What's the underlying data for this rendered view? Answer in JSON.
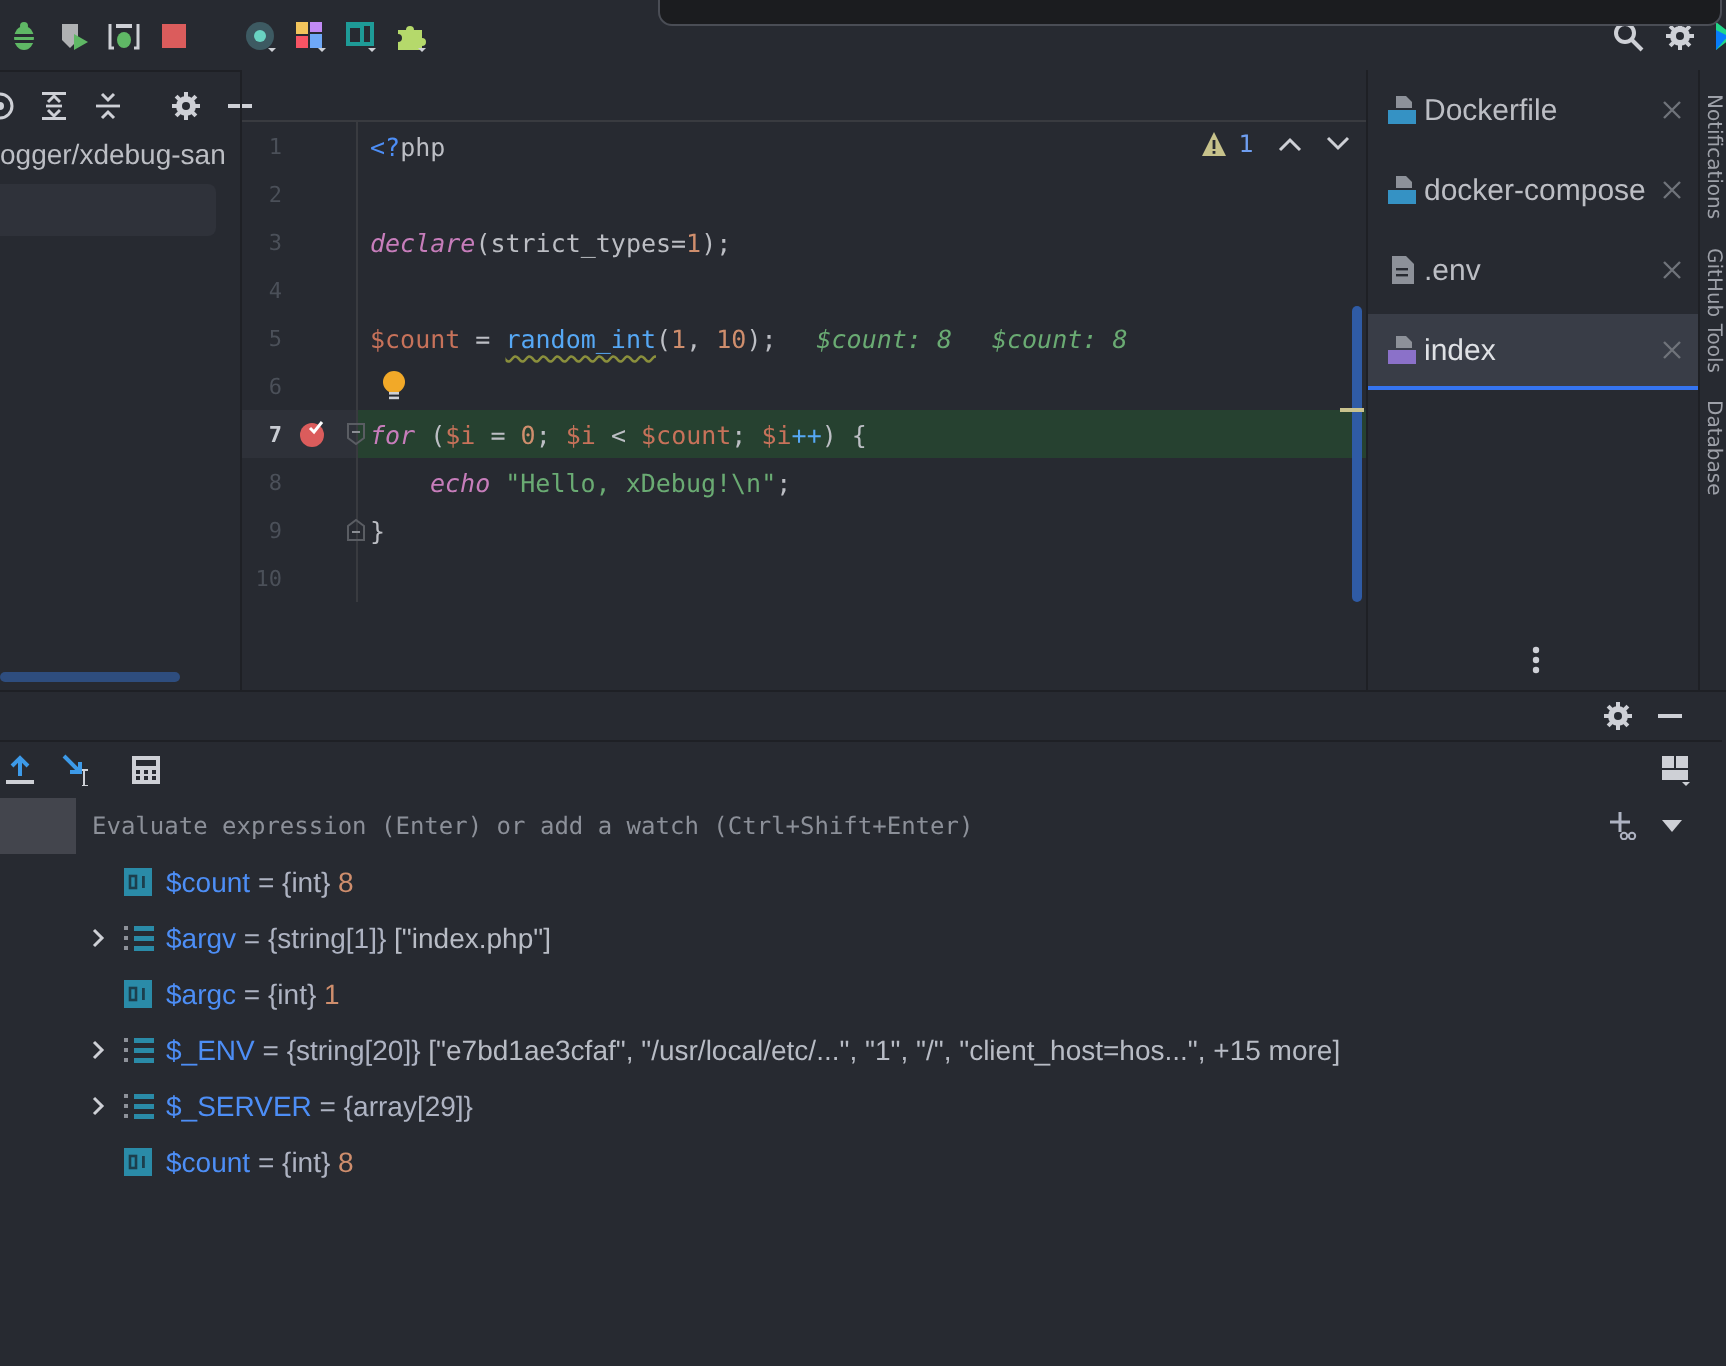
{
  "project": {
    "path": "ogger/xdebug-san"
  },
  "editor": {
    "problems": {
      "count": "1"
    },
    "lines": [
      {
        "number": "1",
        "current": false,
        "breakpoint": false,
        "bulb": false,
        "fold_start": false,
        "fold_end": false,
        "indented": false,
        "tokens": [
          {
            "kind": "tag",
            "text": "<?"
          },
          {
            "kind": "plain",
            "text": "php"
          }
        ]
      },
      {
        "number": "2",
        "current": false,
        "breakpoint": false,
        "bulb": false,
        "fold_start": false,
        "fold_end": false,
        "indented": false
      },
      {
        "number": "3",
        "current": false,
        "breakpoint": false,
        "bulb": false,
        "fold_start": false,
        "fold_end": false,
        "indented": false,
        "tokens": [
          {
            "kind": "keyword",
            "text": "declare"
          },
          {
            "kind": "plain",
            "text": "(strict_types="
          },
          {
            "kind": "number",
            "text": "1"
          },
          {
            "kind": "plain",
            "text": ");"
          }
        ]
      },
      {
        "number": "4",
        "current": false,
        "breakpoint": false,
        "bulb": false,
        "fold_start": false,
        "fold_end": false,
        "indented": false
      },
      {
        "number": "5",
        "current": false,
        "breakpoint": false,
        "bulb": false,
        "fold_start": false,
        "fold_end": false,
        "indented": false,
        "tokens": [
          {
            "kind": "variable",
            "text": "$count"
          },
          {
            "kind": "plain",
            "text": " = "
          },
          {
            "kind": "flagged",
            "text": "random_int"
          },
          {
            "kind": "plain",
            "text": "("
          },
          {
            "kind": "number",
            "text": "1"
          },
          {
            "kind": "plain",
            "text": ", "
          },
          {
            "kind": "number",
            "text": "10"
          },
          {
            "kind": "plain",
            "text": ");"
          }
        ],
        "hints": [
          "$count: 8",
          "$count: 8"
        ]
      },
      {
        "number": "6",
        "current": false,
        "breakpoint": false,
        "bulb": true,
        "fold_start": false,
        "fold_end": false,
        "indented": false
      },
      {
        "number": "7",
        "current": true,
        "breakpoint": true,
        "bulb": false,
        "fold_start": true,
        "fold_end": false,
        "indented": false,
        "tokens": [
          {
            "kind": "keyword",
            "text": "for"
          },
          {
            "kind": "plain",
            "text": " ("
          },
          {
            "kind": "variable",
            "text": "$i"
          },
          {
            "kind": "plain",
            "text": " = "
          },
          {
            "kind": "number",
            "text": "0"
          },
          {
            "kind": "plain",
            "text": "; "
          },
          {
            "kind": "variable",
            "text": "$i"
          },
          {
            "kind": "plain",
            "text": " < "
          },
          {
            "kind": "variable",
            "text": "$count"
          },
          {
            "kind": "plain",
            "text": "; "
          },
          {
            "kind": "variable",
            "text": "$i"
          },
          {
            "kind": "operator",
            "text": "++"
          },
          {
            "kind": "plain",
            "text": ") {"
          }
        ]
      },
      {
        "number": "8",
        "current": false,
        "breakpoint": false,
        "bulb": false,
        "fold_start": false,
        "fold_end": false,
        "indented": true,
        "tokens": [
          {
            "kind": "keyword",
            "text": "echo"
          },
          {
            "kind": "string",
            "text": " \"Hello, xDebug!\\n\""
          },
          {
            "kind": "plain",
            "text": ";"
          }
        ]
      },
      {
        "number": "9",
        "current": false,
        "breakpoint": false,
        "bulb": false,
        "fold_start": false,
        "fold_end": true,
        "indented": false,
        "tokens": [
          {
            "kind": "plain",
            "text": "}"
          }
        ]
      },
      {
        "number": "10",
        "current": false,
        "breakpoint": false,
        "bulb": false,
        "fold_start": false,
        "fold_end": false,
        "indented": false
      }
    ]
  },
  "tabs": [
    {
      "label": "Dockerfile",
      "kind": "docker",
      "selected": false
    },
    {
      "label": "docker-compose",
      "kind": "compose",
      "selected": false
    },
    {
      "label": ".env",
      "kind": "text",
      "selected": false
    },
    {
      "label": "index",
      "kind": "php",
      "selected": true
    }
  ],
  "side_tools": [
    "Notifications",
    "GitHub Tools",
    "Database"
  ],
  "debugger": {
    "evaluate": {
      "placeholder": "Evaluate expression (Enter) or add a watch (Ctrl+Shift+Enter)"
    },
    "variables": [
      {
        "kind": "scalar",
        "name": "$count",
        "op": "=",
        "type": "{int}",
        "value": {
          "kind": "number",
          "text": "8"
        }
      },
      {
        "kind": "array",
        "expanded": false,
        "name": "$argv",
        "op": "=",
        "type": "{string[1]}",
        "value": {
          "kind": "text",
          "text": "[\"index.php\"]"
        }
      },
      {
        "kind": "scalar",
        "name": "$argc",
        "op": "=",
        "type": "{int}",
        "value": {
          "kind": "number",
          "text": "1"
        }
      },
      {
        "kind": "array",
        "expanded": false,
        "name": "$_ENV",
        "op": "=",
        "type": "{string[20]}",
        "value": {
          "kind": "text",
          "text": "[\"e7bd1ae3cfaf\", \"/usr/local/etc/...\", \"1\", \"/\", \"client_host=hos...\", +15 more]"
        }
      },
      {
        "kind": "array",
        "expanded": false,
        "name": "$_SERVER",
        "op": "=",
        "type": "{array[29]}"
      },
      {
        "kind": "scalar",
        "name": "$count",
        "op": "=",
        "type": "{int}",
        "value": {
          "kind": "number",
          "text": "8"
        }
      }
    ]
  }
}
